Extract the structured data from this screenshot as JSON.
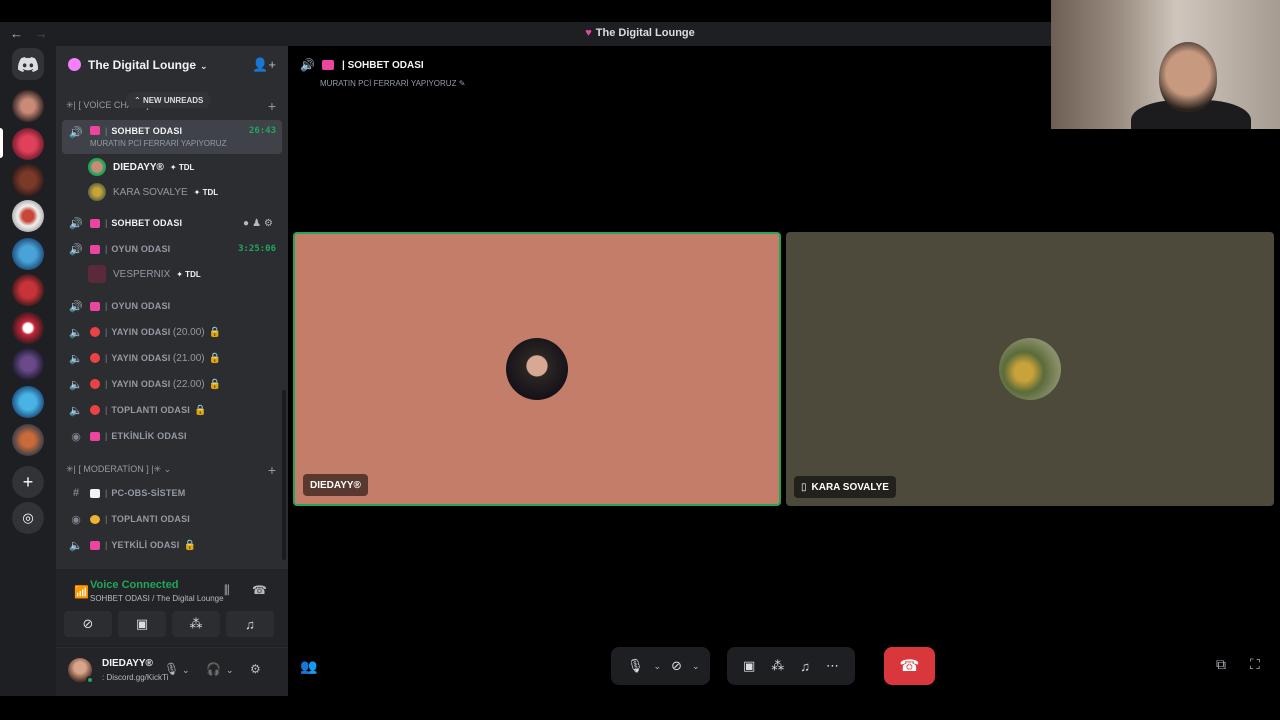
{
  "window": {
    "title": "The Digital Lounge",
    "back": "←",
    "forward": "→"
  },
  "server": {
    "name": "The Digital Lounge"
  },
  "new_unreads": "NEW UNREADS",
  "categories": {
    "voice": "[ VOİCE CHATS ]",
    "voice_prefix": "✳|",
    "moderation": "[ MODERATİON ]",
    "moderation_prefix": "✳|",
    "moderation_suffix": "|✳"
  },
  "channels": [
    {
      "name": "SOHBET ODASI",
      "sub": "MURATIN PCİ FERRARİ YAPIYORUZ",
      "timer": "26:43"
    },
    {
      "name": "SOHBET ODASI"
    },
    {
      "name": "OYUN ODASI",
      "timer": "3:25:06"
    },
    {
      "name": "OYUN ODASI"
    },
    {
      "name": "YAYIN ODASI",
      "extra": "(20.00)"
    },
    {
      "name": "YAYIN ODASI",
      "extra": "(21.00)"
    },
    {
      "name": "YAYIN ODASI",
      "extra": "(22.00)"
    },
    {
      "name": "TOPLANTI ODASI"
    },
    {
      "name": "ETKİNLİK ODASI"
    },
    {
      "name": "PC-OBS-SİSTEM"
    },
    {
      "name": "TOPLANTI ODASI"
    },
    {
      "name": "YETKİLİ ODASI"
    }
  ],
  "members": [
    {
      "name": "DIEDAYY®",
      "tag": "✦ TDL"
    },
    {
      "name": "KARA SOVALYE",
      "tag": "✦ TDL"
    },
    {
      "name": "VESPERNIX",
      "tag": "✦ TDL"
    }
  ],
  "voice_status": {
    "title": "Voice Connected",
    "location": "SOHBET ODASI / The Digital Lounge"
  },
  "user": {
    "name": "DIEDAYY®",
    "status": ": Discord.gg/KickTi"
  },
  "call": {
    "channel": "SOHBET ODASI",
    "topic": "MURATIN PCİ FERRARİ YAPIYORUZ",
    "tiles": [
      {
        "name": "DIEDAYY®"
      },
      {
        "name": "KARA SOVALYE"
      }
    ]
  },
  "colors": {
    "accent_green": "#23a55a",
    "hangup_red": "#da373c",
    "tile1_bg": "#c47d68",
    "tile2_bg": "#4d4a3c"
  }
}
